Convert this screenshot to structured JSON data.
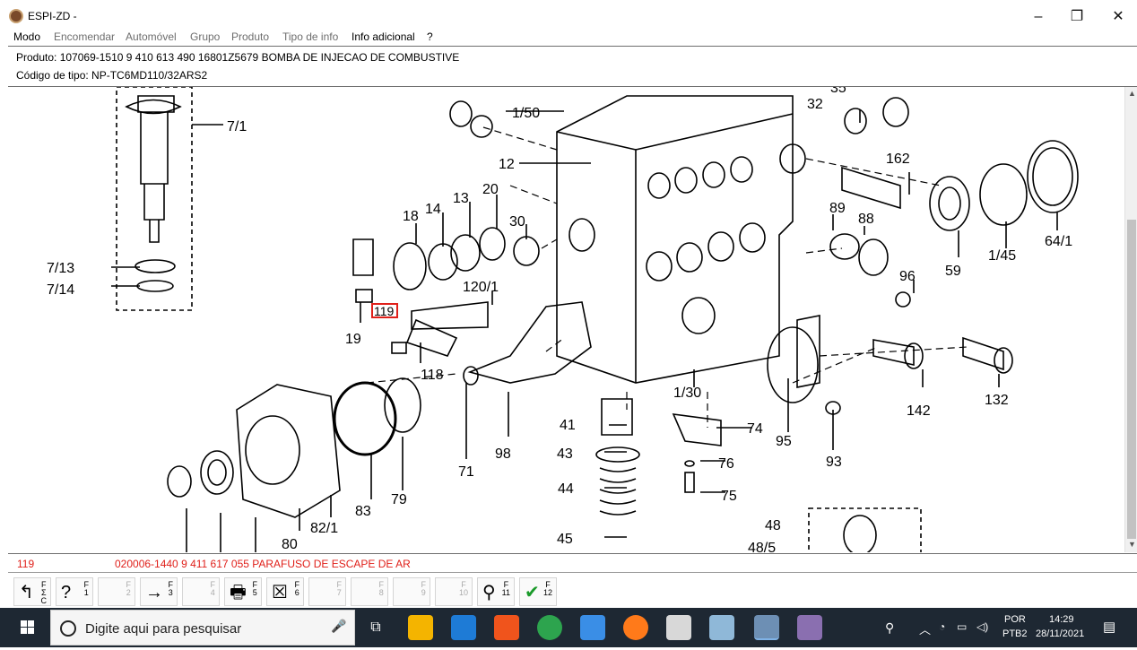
{
  "window": {
    "title": "ESPI-ZD -",
    "controls": {
      "minimize": "–",
      "restore": "❐",
      "close": "✕"
    }
  },
  "menu": [
    "Modo",
    "Encomendar",
    "Automóvel",
    "Grupo",
    "Produto",
    "Tipo de info",
    "Info adicional",
    "?"
  ],
  "info": {
    "product_line": "Produto:  107069-1510  9 410 613 490  16801Z5679  BOMBA DE INJECAO DE COMBUSTIVE",
    "type_line": "Código de tipo: NP-TC6MD110/32ARS2"
  },
  "diagram": {
    "highlight_label": "119",
    "labels": [
      "7/1",
      "7/13",
      "7/14",
      "1/50",
      "12",
      "32",
      "35",
      "162",
      "18",
      "14",
      "13",
      "20",
      "30",
      "89",
      "88",
      "59",
      "1/45",
      "64/1",
      "96",
      "120/1",
      "19",
      "118",
      "1/30",
      "142",
      "132",
      "41",
      "74",
      "95",
      "93",
      "98",
      "71",
      "43",
      "76",
      "44",
      "75",
      "83",
      "79",
      "82/1",
      "80",
      "45",
      "48",
      "48/5"
    ]
  },
  "status": {
    "number": "119",
    "description": "020006-1440   9 411 617 055   PARAFUSO DE ESCAPE DE AR"
  },
  "toolbar": {
    "keys": [
      {
        "key": "F\nΣ\nC",
        "icon": "return-icon",
        "glyph": "↰"
      },
      {
        "key": "F\n1",
        "icon": "help-icon",
        "glyph": "?"
      },
      {
        "key": "F\n2",
        "icon": "",
        "glyph": ""
      },
      {
        "key": "F\n3",
        "icon": "",
        "glyph": "→"
      },
      {
        "key": "F\n4",
        "icon": "",
        "glyph": ""
      },
      {
        "key": "F\n5",
        "icon": "print-icon",
        "glyph": "🖶"
      },
      {
        "key": "F\n6",
        "icon": "close-list-icon",
        "glyph": "☒"
      },
      {
        "key": "F\n7",
        "icon": "",
        "glyph": ""
      },
      {
        "key": "F\n8",
        "icon": "",
        "glyph": ""
      },
      {
        "key": "F\n9",
        "icon": "",
        "glyph": ""
      },
      {
        "key": "F\n10",
        "icon": "",
        "glyph": ""
      },
      {
        "key": "F\n11",
        "icon": "zoom-icon",
        "glyph": "⚲"
      },
      {
        "key": "F\n12",
        "icon": "confirm-icon",
        "glyph": "✔"
      }
    ]
  },
  "taskbar": {
    "search_placeholder": "Digite aqui para pesquisar",
    "lang": "POR",
    "layout": "PTB2",
    "time": "14:29",
    "date": "28/11/2021"
  },
  "colors": {
    "status_red": "#e0201a",
    "taskbar": "#1e2833",
    "highlight_box": "#e0201a"
  }
}
